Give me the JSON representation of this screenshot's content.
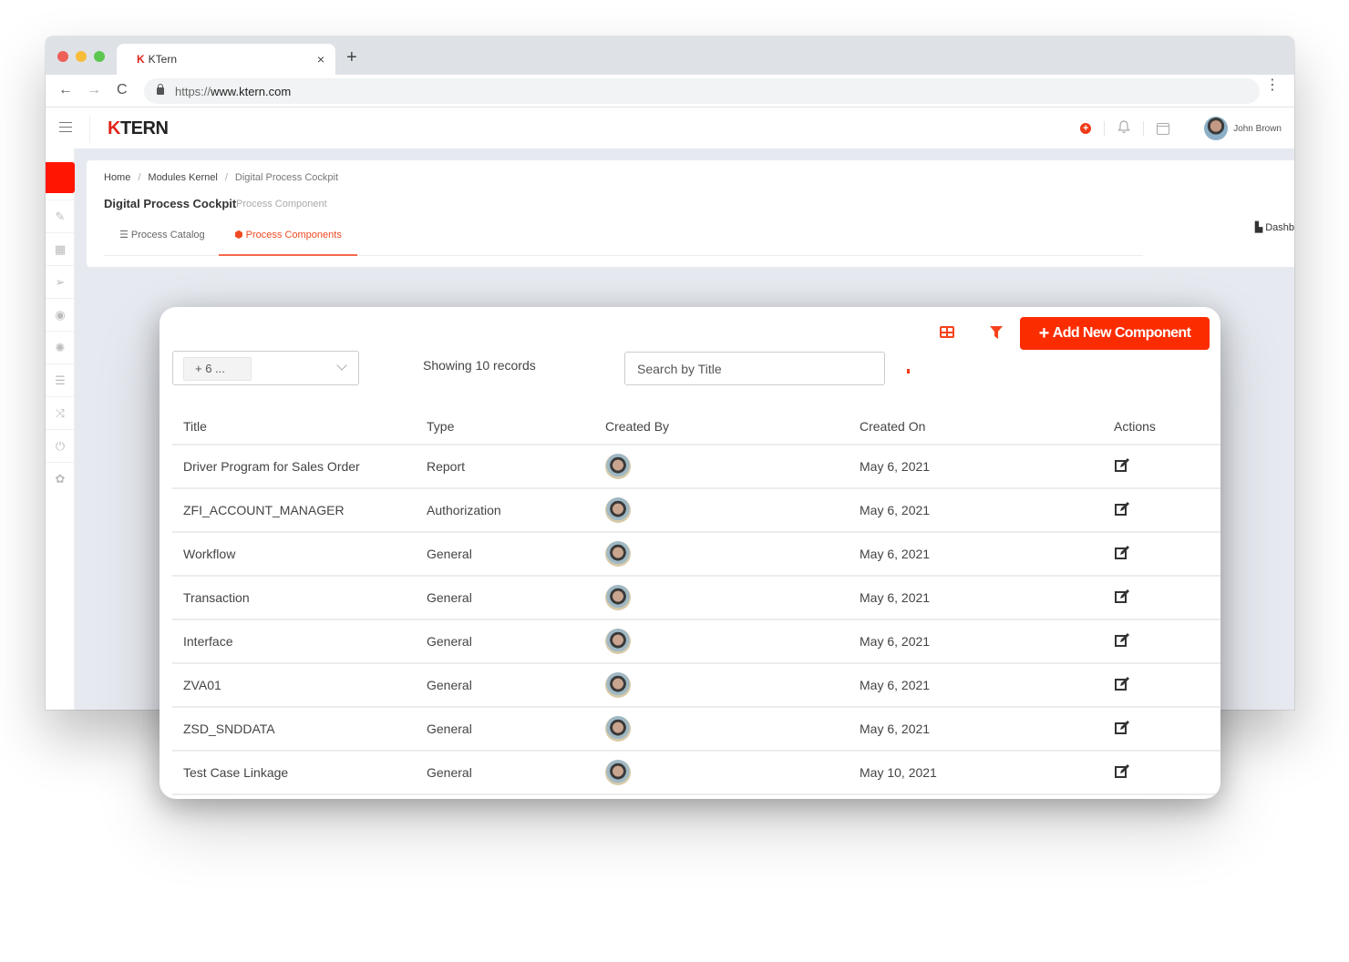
{
  "browser": {
    "tab_title": "KTern",
    "tab_logo": "K",
    "new_tab": "+",
    "close": "×",
    "url_scheme": "https://",
    "url_host": "www.ktern.com",
    "nav": {
      "back": "←",
      "forward": "→",
      "reload": "C",
      "menu": "⋮"
    }
  },
  "header": {
    "logo_k": "K",
    "logo_rest": "TERN",
    "add_icon": "+",
    "bell_icon": "🔔",
    "user_name": "John Brown"
  },
  "sidebar": {
    "items": [
      {
        "icon": "✎",
        "name": "notes"
      },
      {
        "icon": "▦",
        "name": "dashboard"
      },
      {
        "icon": "➢",
        "name": "send"
      },
      {
        "icon": "◉",
        "name": "fire"
      },
      {
        "icon": "✺",
        "name": "idea"
      },
      {
        "icon": "☰",
        "name": "list"
      },
      {
        "icon": "⤨",
        "name": "shuffle"
      },
      {
        "icon": "⏻",
        "name": "power"
      },
      {
        "icon": "✿",
        "name": "settings"
      }
    ]
  },
  "page": {
    "breadcrumb": [
      "Home",
      "Modules Kernel",
      "Digital Process Cockpit"
    ],
    "breadcrumb_sep": "/",
    "title": "Digital Process Cockpit",
    "subtitle": "Process Component",
    "tabs": [
      {
        "label": "☰ Process Catalog",
        "active": false
      },
      {
        "label": "⬢ Process Components",
        "active": true
      }
    ],
    "dashboard_link": "▙ Dashb"
  },
  "card": {
    "add_button": "Add New Component",
    "add_plus": "+",
    "multiselect_chip": "+ 6 ...",
    "records_text": "Showing 10 records",
    "search_placeholder": "Search by Title",
    "columns": [
      "Title",
      "Type",
      "Created By",
      "Created On",
      "Actions"
    ],
    "rows": [
      {
        "title": "Driver Program for Sales Order",
        "type": "Report",
        "created_on": "May 6, 2021"
      },
      {
        "title": "ZFI_ACCOUNT_MANAGER",
        "type": "Authorization",
        "created_on": "May 6, 2021"
      },
      {
        "title": "Workflow",
        "type": "General",
        "created_on": "May 6, 2021"
      },
      {
        "title": "Transaction",
        "type": "General",
        "created_on": "May 6, 2021"
      },
      {
        "title": "Interface",
        "type": "General",
        "created_on": "May 6, 2021"
      },
      {
        "title": "ZVA01",
        "type": "General",
        "created_on": "May 6, 2021"
      },
      {
        "title": "ZSD_SNDDATA",
        "type": "General",
        "created_on": "May 6, 2021"
      },
      {
        "title": "Test Case Linkage",
        "type": "General",
        "created_on": "May 10, 2021"
      }
    ]
  },
  "colors": {
    "accent": "#fb2d00",
    "tab_active": "#f04a22",
    "sidebar_active": "#ff1500"
  }
}
